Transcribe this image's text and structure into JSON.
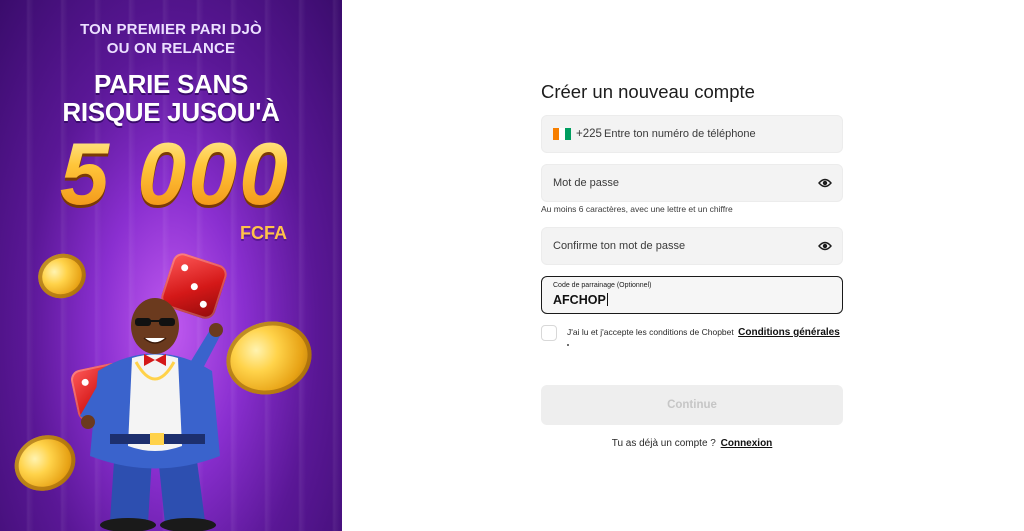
{
  "promo": {
    "tagline_line1": "TON PREMIER PARI DJÒ",
    "tagline_line2": "OU ON RELANCE",
    "headline_line1": "PARIE SANS",
    "headline_line2": "RISQUE JUSOU'À",
    "amount": "5 000",
    "currency": "FCFA",
    "colors": {
      "background_start": "#c05af0",
      "background_end": "#3a0c6c",
      "gold": "#ffb21f",
      "dice_red": "#d41818"
    }
  },
  "form": {
    "title": "Créer un nouveau compte",
    "phone": {
      "country_flag": "cote-d-ivoire-flag-icon",
      "prefix": "+225",
      "placeholder": "Entre ton numéro de téléphone"
    },
    "password": {
      "placeholder": "Mot de passe",
      "toggle_icon": "eye-icon",
      "hint": "Au moins 6 caractères, avec une lettre et un chiffre"
    },
    "confirm_password": {
      "placeholder": "Confirme ton mot de passe",
      "toggle_icon": "eye-icon"
    },
    "referral": {
      "label": "Code de parrainage (Optionnel)",
      "value": "AFCHOP"
    },
    "terms": {
      "text": "J'ai lu et j'accepte les conditions de Chopbet",
      "link": "Conditions générales",
      "checked": false
    },
    "continue_label": "Continue",
    "login_prompt": "Tu as déjà un compte ?",
    "login_link": "Connexion"
  }
}
